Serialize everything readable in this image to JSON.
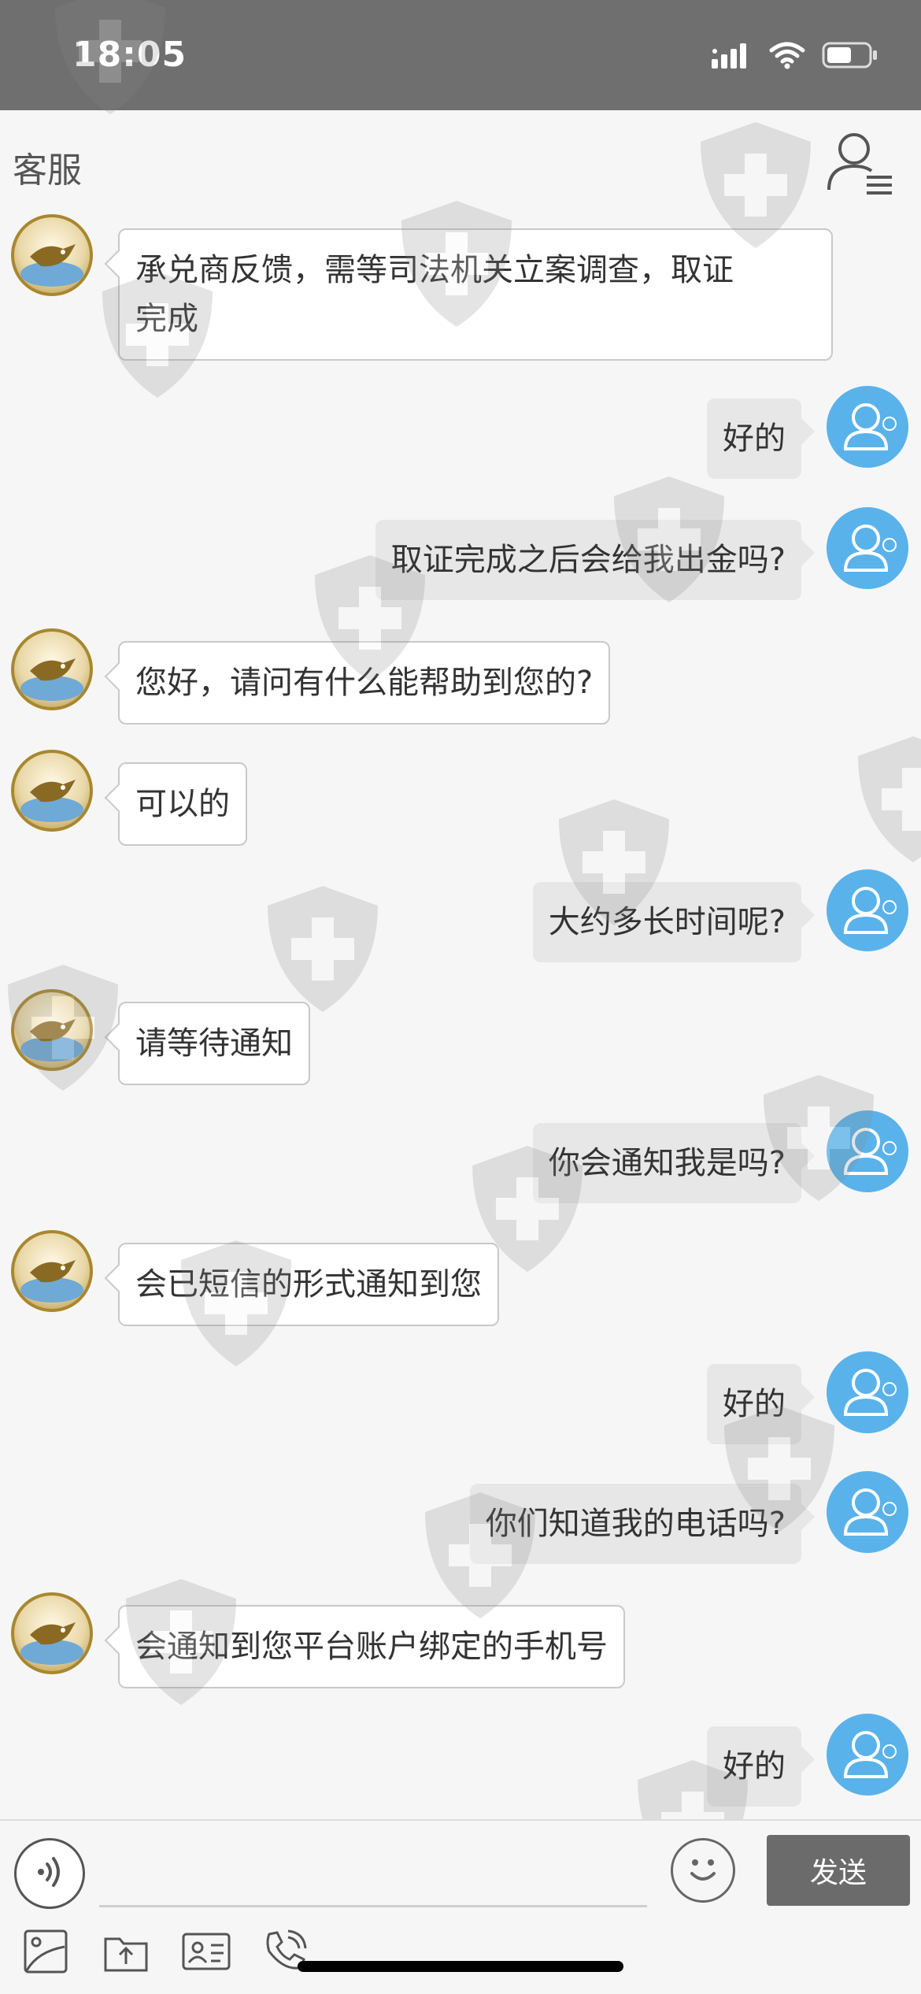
{
  "status_bar": {
    "time": "18:05",
    "icons": [
      "signal-icon",
      "wifi-icon",
      "battery-icon"
    ]
  },
  "header": {
    "title": "客服"
  },
  "messages": [
    {
      "sender": "agent",
      "text": "承兑商反馈，需等司法机关立案调查，取证\n完成"
    },
    {
      "sender": "user",
      "text": "好的"
    },
    {
      "sender": "user",
      "text": "取证完成之后会给我出金吗?"
    },
    {
      "sender": "agent",
      "text": "您好，请问有什么能帮助到您的?"
    },
    {
      "sender": "agent",
      "text": "可以的"
    },
    {
      "sender": "user",
      "text": "大约多长时间呢?"
    },
    {
      "sender": "agent",
      "text": "请等待通知"
    },
    {
      "sender": "user",
      "text": "你会通知我是吗?"
    },
    {
      "sender": "agent",
      "text": "会已短信的形式通知到您"
    },
    {
      "sender": "user",
      "text": "好的"
    },
    {
      "sender": "user",
      "text": "你们知道我的电话吗?"
    },
    {
      "sender": "agent",
      "text": "会通知到您平台账户绑定的手机号"
    },
    {
      "sender": "user",
      "text": "好的"
    }
  ],
  "input": {
    "value": "",
    "placeholder": "",
    "send_label": "发送"
  },
  "toolbar": {
    "icons": [
      "image-icon",
      "upload-file-icon",
      "contact-card-icon",
      "phone-icon"
    ]
  },
  "colors": {
    "status_bar": "#6f6f6f",
    "user_avatar": "#5ab2ea",
    "user_bubble": "#e7e7e7",
    "send_button": "#6b6b6b"
  }
}
